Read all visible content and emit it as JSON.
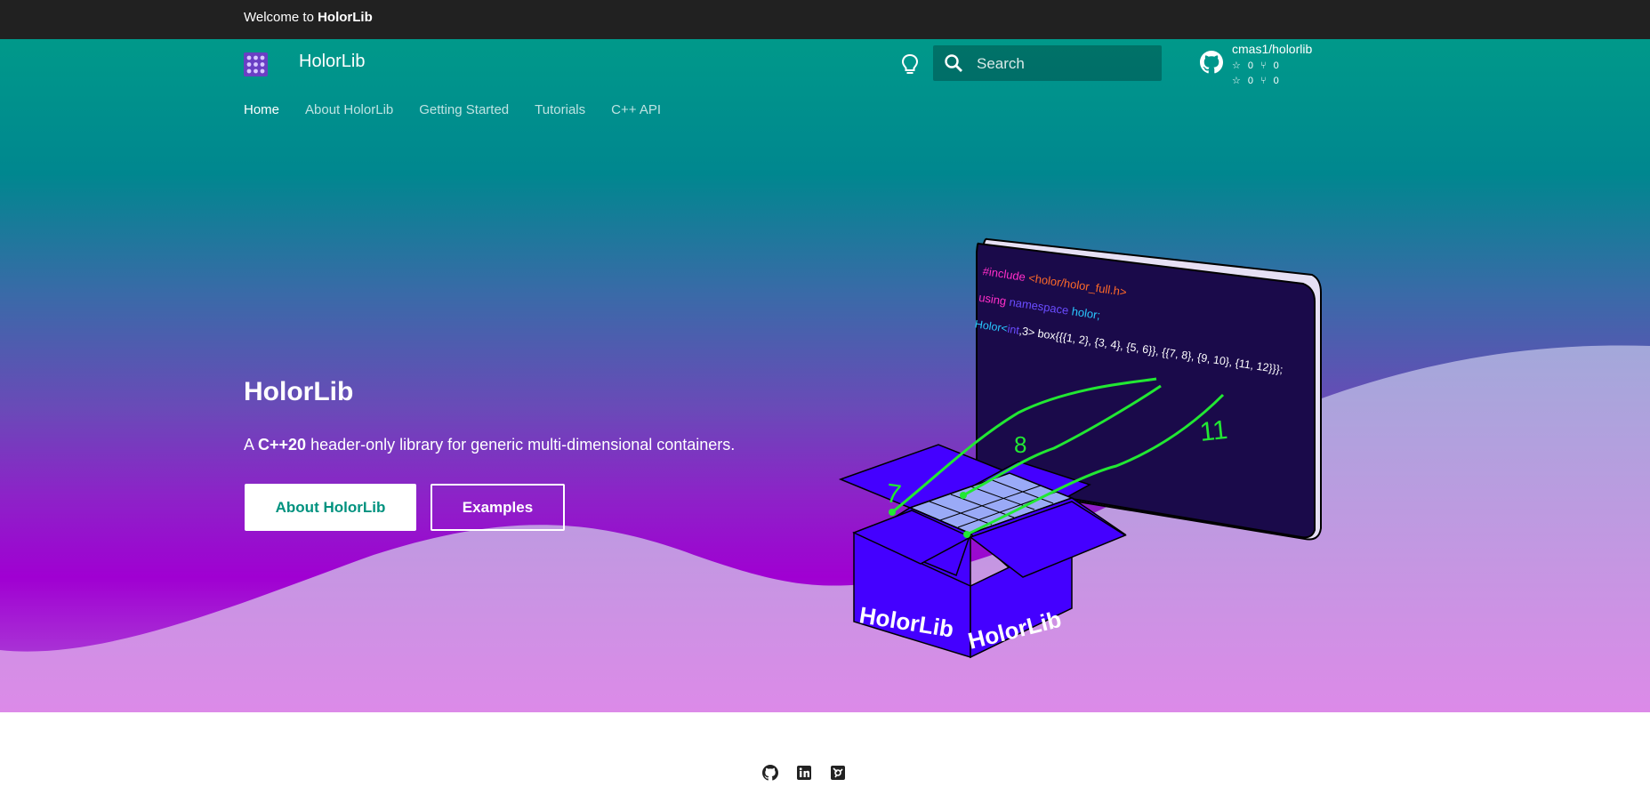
{
  "topbar": {
    "prefix": "Welcome to ",
    "brand": "HolorLib"
  },
  "header": {
    "site_name": "HolorLib",
    "search_placeholder": "Search",
    "repo": {
      "name": "cmas1/holorlib",
      "stars_1": "0",
      "forks_1": "0",
      "stars_2": "0",
      "forks_2": "0"
    }
  },
  "nav": {
    "tabs": [
      "Home",
      "About HolorLib",
      "Getting Started",
      "Tutorials",
      "C++ API"
    ]
  },
  "hero": {
    "title": "HolorLib",
    "subtitle_prefix": "A ",
    "subtitle_bold": "C++20",
    "subtitle_suffix": " header-only library for generic multi-dimensional containers.",
    "primary_button": "About HolorLib",
    "secondary_button": "Examples"
  },
  "illustration": {
    "code_line1_kw": "#include",
    "code_line1_arg": "<holor/holor_full.h>",
    "code_line2_kw1": "using",
    "code_line2_kw2": "namespace",
    "code_line2_arg": "holor;",
    "code_line3_kw": "Holor<",
    "code_line3_type": "int",
    "code_line3_rest": ",3> box{{{1, 2}, {3, 4}, {5, 6}}, {{7, 8}, {9, 10}, {11, 12}}};",
    "number_a": "7",
    "number_b": "8",
    "number_c": "11",
    "box_label_left": "HolorLib",
    "box_label_right": "HolorLib"
  },
  "colors": {
    "accent": "#00927f",
    "topbar": "#212121",
    "code_bg": "#1a0a4a",
    "box": "#4400ff",
    "pointer": "#22e833"
  },
  "footer": {
    "icons": [
      "github-icon",
      "linkedin-icon",
      "sourcegraph-icon"
    ]
  }
}
